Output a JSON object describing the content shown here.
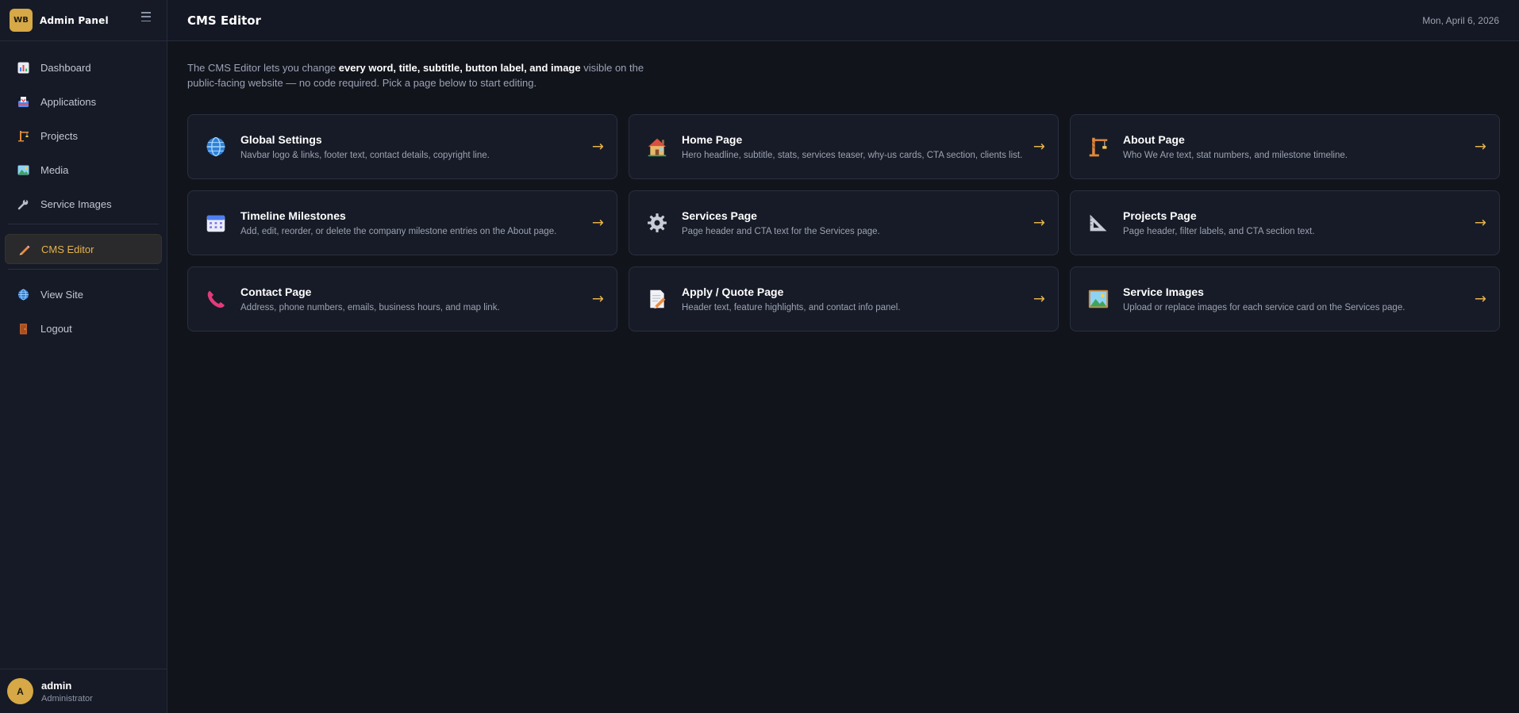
{
  "brand": {
    "logo_text": "WB",
    "name": "Admin Panel"
  },
  "sidebar": {
    "items": [
      {
        "label": "Dashboard",
        "icon": "bar-chart-icon"
      },
      {
        "label": "Applications",
        "icon": "inbox-tray-icon"
      },
      {
        "label": "Projects",
        "icon": "construction-crane-icon"
      },
      {
        "label": "Media",
        "icon": "picture-icon"
      },
      {
        "label": "Service Images",
        "icon": "wrench-icon"
      },
      {
        "label": "CMS Editor",
        "icon": "pencil-icon",
        "active": true
      },
      {
        "label": "View Site",
        "icon": "globe-icon"
      },
      {
        "label": "Logout",
        "icon": "door-icon"
      }
    ]
  },
  "user": {
    "initial": "A",
    "name": "admin",
    "role": "Administrator"
  },
  "header": {
    "title": "CMS Editor",
    "date": "Mon, April 6, 2026"
  },
  "intro": {
    "part1": "The CMS Editor lets you change ",
    "bold": "every word, title, subtitle, button label, and image",
    "part2": " visible on the public-facing website — no code required. Pick a page below to start editing."
  },
  "cards": [
    {
      "title": "Global Settings",
      "desc": "Navbar logo & links, footer text, contact details, copyright line.",
      "icon": "globe-icon"
    },
    {
      "title": "Home Page",
      "desc": "Hero headline, subtitle, stats, services teaser, why-us cards, CTA section, clients list.",
      "icon": "house-icon"
    },
    {
      "title": "About Page",
      "desc": "Who We Are text, stat numbers, and milestone timeline.",
      "icon": "construction-crane-icon"
    },
    {
      "title": "Timeline Milestones",
      "desc": "Add, edit, reorder, or delete the company milestone entries on the About page.",
      "icon": "calendar-icon"
    },
    {
      "title": "Services Page",
      "desc": "Page header and CTA text for the Services page.",
      "icon": "gear-icon"
    },
    {
      "title": "Projects Page",
      "desc": "Page header, filter labels, and CTA section text.",
      "icon": "triangle-ruler-icon"
    },
    {
      "title": "Contact Page",
      "desc": "Address, phone numbers, emails, business hours, and map link.",
      "icon": "phone-icon"
    },
    {
      "title": "Apply / Quote Page",
      "desc": "Header text, feature highlights, and contact info panel.",
      "icon": "memo-icon"
    },
    {
      "title": "Service Images",
      "desc": "Upload or replace images for each service card on the Services page.",
      "icon": "picture-icon"
    }
  ],
  "arrow_glyph": "→",
  "colors": {
    "accent": "#e6b34c",
    "background": "#12141c",
    "sidebar": "#161a26",
    "card": "#171b27"
  }
}
